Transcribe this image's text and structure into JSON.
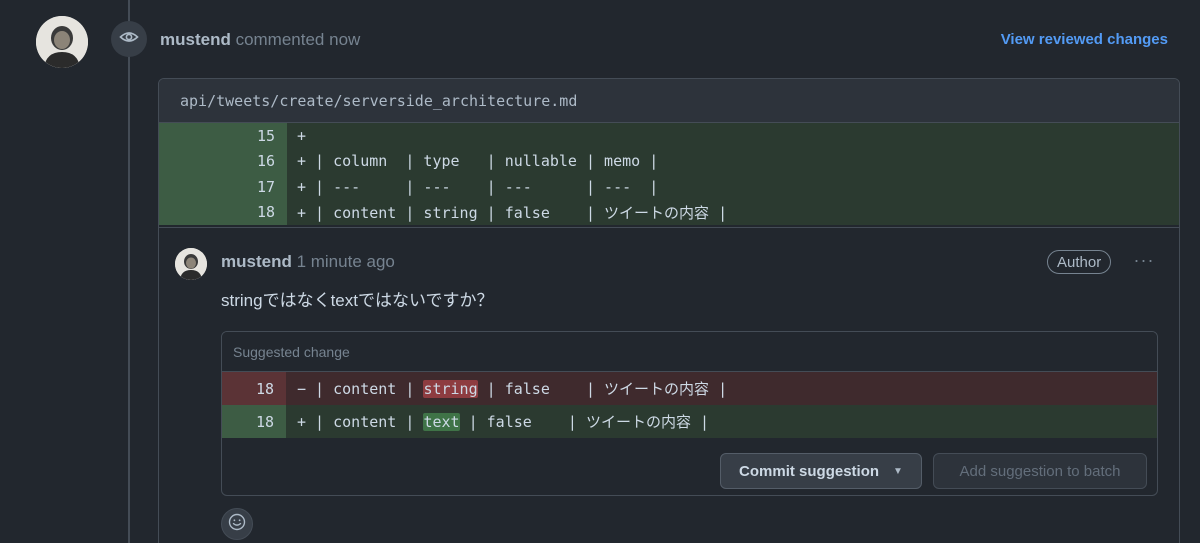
{
  "header": {
    "username": "mustend",
    "action": " commented now",
    "view_link": "View reviewed changes"
  },
  "file": {
    "path": "api/tweets/create/serverside_architecture.md",
    "lines": [
      {
        "num": "15",
        "code": "+"
      },
      {
        "num": "16",
        "code": "+ | column  | type   | nullable | memo |"
      },
      {
        "num": "17",
        "code": "+ | ---     | ---    | ---      | ---  |"
      },
      {
        "num": "18",
        "code": "+ | content | string | false    | ツイートの内容 |"
      }
    ]
  },
  "comment": {
    "username": "mustend",
    "time": " 1 minute ago",
    "badge": "Author",
    "more_label": "···",
    "body": "stringではなくtextではないですか？"
  },
  "suggestion": {
    "title": "Suggested change",
    "removed": {
      "num": "18",
      "prefix": "− | content | ",
      "highlight": "string",
      "suffix": " | false    | ツイートの内容 |"
    },
    "added": {
      "num": "18",
      "prefix": "+ | content | ",
      "highlight": "text",
      "suffix": " | false    | ツイートの内容 |"
    },
    "commit_label": "Commit suggestion",
    "batch_label": "Add suggestion to batch"
  },
  "icons": {
    "review": "eye-icon",
    "reaction": "smiley-icon",
    "commit_dropdown": "caret-down-icon"
  },
  "colors": {
    "link": "#539bf5",
    "addition_bg": "#2b3a30",
    "deletion_bg": "#3f2a2d"
  }
}
